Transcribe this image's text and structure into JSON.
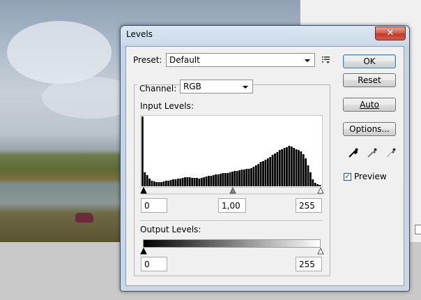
{
  "window": {
    "title": "Levels",
    "close_glyph": "✕"
  },
  "preset": {
    "label": "Preset:",
    "value": "Default",
    "menu_icon": "preset-options-icon"
  },
  "channel": {
    "label": "Channel:",
    "value": "RGB"
  },
  "input_levels": {
    "label": "Input Levels:",
    "black": "0",
    "gamma": "1,00",
    "white": "255"
  },
  "output_levels": {
    "label": "Output Levels:",
    "black": "0",
    "white": "255"
  },
  "buttons": {
    "ok": "OK",
    "reset": "Reset",
    "auto": "Auto",
    "options": "Options..."
  },
  "eyedroppers": [
    "black-point-eyedropper-icon",
    "gray-point-eyedropper-icon",
    "white-point-eyedropper-icon"
  ],
  "preview": {
    "label": "Preview",
    "checked": true
  },
  "colors": {
    "title_bar": "#cfdcea",
    "close": "#c0392b",
    "default_border": "#3c7fb1"
  },
  "histogram": {
    "levels": [
      100,
      20,
      16,
      11,
      8,
      7,
      6,
      6,
      6,
      7,
      8,
      8,
      9,
      10,
      10,
      11,
      11,
      12,
      13,
      13,
      13,
      12,
      12,
      12,
      11,
      12,
      13,
      14,
      15,
      15,
      16,
      17,
      17,
      18,
      19,
      19,
      19,
      20,
      21,
      22,
      22,
      23,
      24,
      24,
      25,
      25,
      26,
      28,
      30,
      32,
      35,
      36,
      38,
      40,
      42,
      45,
      47,
      49,
      52,
      53,
      55,
      56,
      58,
      57,
      55,
      53,
      52,
      50,
      46,
      40,
      30,
      20,
      10,
      5,
      3,
      2
    ]
  }
}
